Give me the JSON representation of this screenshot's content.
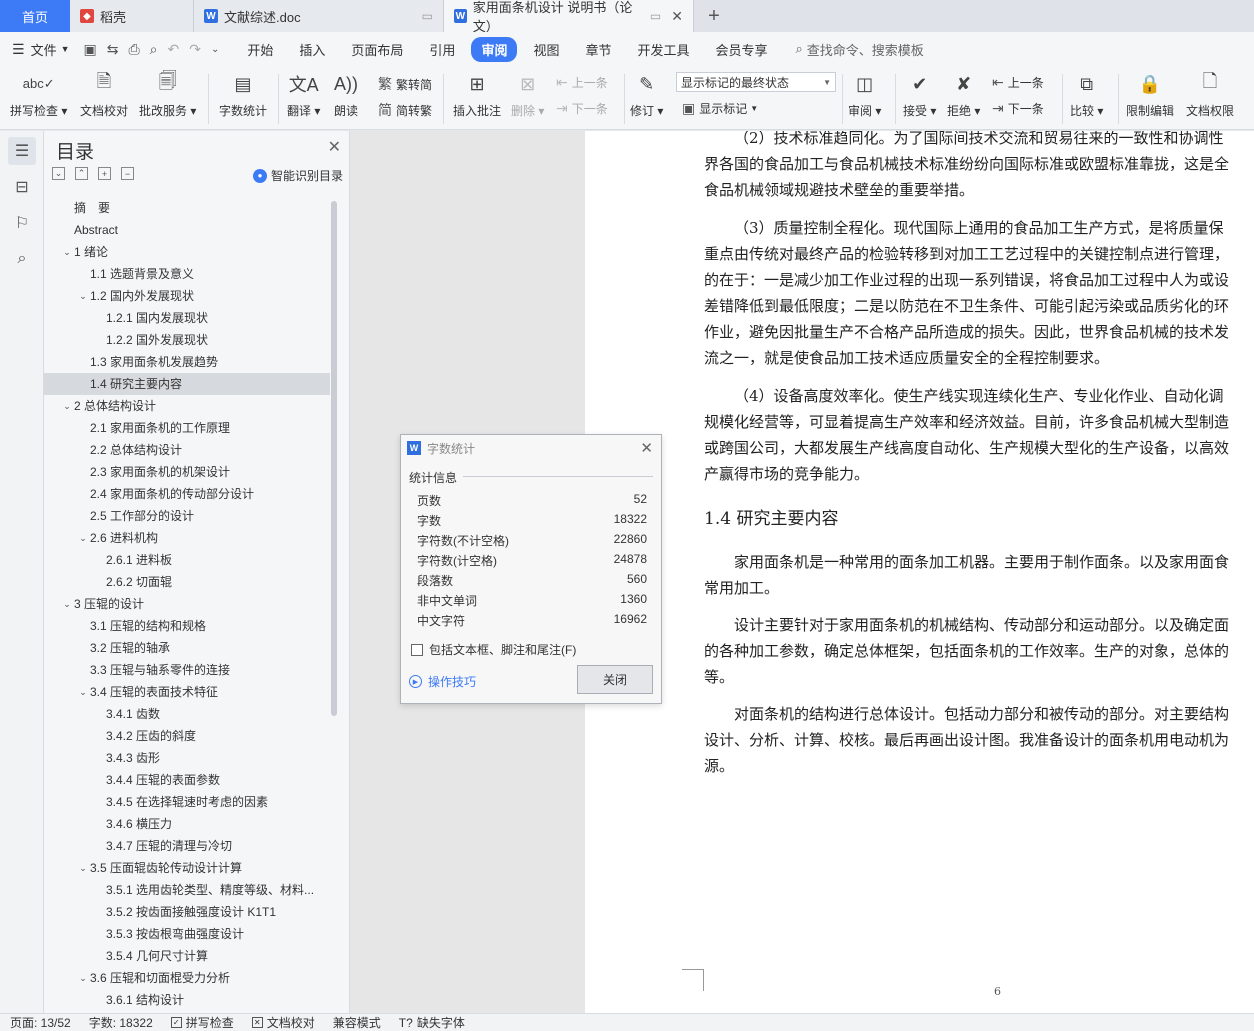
{
  "tabs": {
    "home": "首页",
    "daoke": "稻壳",
    "doc1": "文献综述.doc",
    "doc2": "家用面条机设计 说明书（论文）",
    "add": "+"
  },
  "menu": {
    "file": "文件",
    "items": [
      "开始",
      "插入",
      "页面布局",
      "引用",
      "审阅",
      "视图",
      "章节",
      "开发工具",
      "会员专享"
    ],
    "active": "审阅",
    "search_placeholder": "查找命令、搜索模板"
  },
  "ribbon": {
    "spell_check": "拼写检查",
    "doc_proof": "文档校对",
    "batch_service": "批改服务",
    "word_count": "字数统计",
    "translate": "翻译",
    "read_aloud": "朗读",
    "trad_simp": "繁转简",
    "simp_trad": "简转繁",
    "insert_comment": "插入批注",
    "delete": "删除",
    "prev_comment": "上一条",
    "next_comment": "下一条",
    "track_changes": "修订",
    "markup_mode": "显示标记的最终状态",
    "show_markup": "显示标记",
    "review": "审阅",
    "accept": "接受",
    "reject": "拒绝",
    "prev_change": "上一条",
    "next_change": "下一条",
    "compare": "比较",
    "restrict_edit": "限制编辑",
    "doc_permission": "文档权限"
  },
  "toc": {
    "title": "目录",
    "smart_label": "智能识别目录",
    "items": [
      {
        "text": "摘　要",
        "level": 1,
        "caret": ""
      },
      {
        "text": "Abstract",
        "level": 1,
        "caret": ""
      },
      {
        "text": "1 绪论",
        "level": 1,
        "caret": "v"
      },
      {
        "text": "1.1 选题背景及意义",
        "level": 2,
        "caret": ""
      },
      {
        "text": "1.2 国内外发展现状",
        "level": 2,
        "caret": "v"
      },
      {
        "text": "1.2.1 国内发展现状",
        "level": 3,
        "caret": ""
      },
      {
        "text": "1.2.2 国外发展现状",
        "level": 3,
        "caret": ""
      },
      {
        "text": "1.3 家用面条机发展趋势",
        "level": 2,
        "caret": ""
      },
      {
        "text": "1.4 研究主要内容",
        "level": 2,
        "caret": "",
        "selected": true
      },
      {
        "text": "2 总体结构设计",
        "level": 1,
        "caret": "v"
      },
      {
        "text": "2.1 家用面条机的工作原理",
        "level": 2,
        "caret": ""
      },
      {
        "text": "2.2 总体结构设计",
        "level": 2,
        "caret": ""
      },
      {
        "text": "2.3 家用面条机的机架设计",
        "level": 2,
        "caret": ""
      },
      {
        "text": "2.4 家用面条机的传动部分设计",
        "level": 2,
        "caret": ""
      },
      {
        "text": "2.5 工作部分的设计",
        "level": 2,
        "caret": ""
      },
      {
        "text": "2.6 进料机构",
        "level": 2,
        "caret": "v"
      },
      {
        "text": "2.6.1 进料板",
        "level": 3,
        "caret": ""
      },
      {
        "text": "2.6.2 切面辊",
        "level": 3,
        "caret": ""
      },
      {
        "text": "3 压辊的设计",
        "level": 1,
        "caret": "v"
      },
      {
        "text": "3.1 压辊的结构和规格",
        "level": 2,
        "caret": ""
      },
      {
        "text": "3.2 压辊的轴承",
        "level": 2,
        "caret": ""
      },
      {
        "text": "3.3 压辊与轴系零件的连接",
        "level": 2,
        "caret": ""
      },
      {
        "text": "3.4 压辊的表面技术特征",
        "level": 2,
        "caret": "v"
      },
      {
        "text": "3.4.1 齿数",
        "level": 3,
        "caret": ""
      },
      {
        "text": "3.4.2 压齿的斜度",
        "level": 3,
        "caret": ""
      },
      {
        "text": "3.4.3 齿形",
        "level": 3,
        "caret": ""
      },
      {
        "text": "3.4.4 压辊的表面参数",
        "level": 3,
        "caret": ""
      },
      {
        "text": "3.4.5 在选择辊速时考虑的因素",
        "level": 3,
        "caret": ""
      },
      {
        "text": "3.4.6 横压力",
        "level": 3,
        "caret": ""
      },
      {
        "text": "3.4.7 压辊的清理与冷切",
        "level": 3,
        "caret": ""
      },
      {
        "text": "3.5 压面辊齿轮传动设计计算",
        "level": 2,
        "caret": "v"
      },
      {
        "text": "3.5.1 选用齿轮类型、精度等级、材料...",
        "level": 3,
        "caret": ""
      },
      {
        "text": "3.5.2 按齿面接触强度设计 K1T1",
        "level": 3,
        "caret": ""
      },
      {
        "text": "3.5.3 按齿根弯曲强度设计",
        "level": 3,
        "caret": ""
      },
      {
        "text": "3.5.4 几何尺寸计算",
        "level": 3,
        "caret": ""
      },
      {
        "text": "3.6 压辊和切面棍受力分析",
        "level": 2,
        "caret": "v"
      },
      {
        "text": "3.6.1 结构设计",
        "level": 3,
        "caret": ""
      }
    ]
  },
  "document": {
    "paragraphs": [
      "（2）技术标准趋同化。为了国际间技术交流和贸易往来的一致性和协调性",
      "界各国的食品加工与食品机械技术标准纷纷向国际标准或欧盟标准靠拢，这是全",
      "食品机械领域规避技术壁垒的重要举措。",
      "（3）质量控制全程化。现代国际上通用的食品加工生产方式，是将质量保",
      "重点由传统对最终产品的检验转移到对加工工艺过程中的关键控制点进行管理，",
      "的在于：一是减少加工作业过程的出现一系列错误，将食品加工过程中人为或设",
      "差错降低到最低限度；二是以防范在不卫生条件、可能引起污染或品质劣化的环",
      "作业，避免因批量生产不合格产品所造成的损失。因此，世界食品机械的技术发",
      "流之一，就是使食品加工技术适应质量安全的全程控制要求。",
      "（4）设备高度效率化。使生产线实现连续化生产、专业化作业、自动化调",
      "规模化经营等，可显着提高生产效率和经济效益。目前，许多食品机械大型制造",
      "或跨国公司，大都发展生产线高度自动化、生产规模大型化的生产设备，以高效",
      "产赢得市场的竞争能力。",
      "家用面条机是一种常用的面条加工机器。主要用于制作面条。以及家用面食",
      "常用加工。",
      "设计主要针对于家用面条机的机械结构、传动部分和运动部分。以及确定面",
      "的各种加工参数，确定总体框架，包括面条机的工作效率。生产的对象，总体的",
      "等。",
      "对面条机的结构进行总体设计。包括动力部分和被传动的部分。对主要结构",
      "设计、分析、计算、校核。最后再画出设计图。我准备设计的面条机用电动机为",
      "源。"
    ],
    "heading": "1.4 研究主要内容",
    "page_number": "6"
  },
  "dialog": {
    "title": "字数统计",
    "group_label": "统计信息",
    "stats": [
      {
        "label": "页数",
        "value": "52"
      },
      {
        "label": "字数",
        "value": "18322"
      },
      {
        "label": "字符数(不计空格)",
        "value": "22860"
      },
      {
        "label": "字符数(计空格)",
        "value": "24878"
      },
      {
        "label": "段落数",
        "value": "560"
      },
      {
        "label": "非中文单词",
        "value": "1360"
      },
      {
        "label": "中文字符",
        "value": "16962"
      }
    ],
    "checkbox_label": "包括文本框、脚注和尾注(F)",
    "tips_label": "操作技巧",
    "close_button": "关闭"
  },
  "status": {
    "page": "页面: 13/52",
    "word_count": "字数: 18322",
    "spell_check": "拼写检查",
    "doc_proof": "文档校对",
    "compat_mode": "兼容模式",
    "missing_font": "缺失字体"
  },
  "colors": {
    "accent": "#3d7af5",
    "wps_red": "#e0463f",
    "word_blue": "#2f6fe0"
  }
}
